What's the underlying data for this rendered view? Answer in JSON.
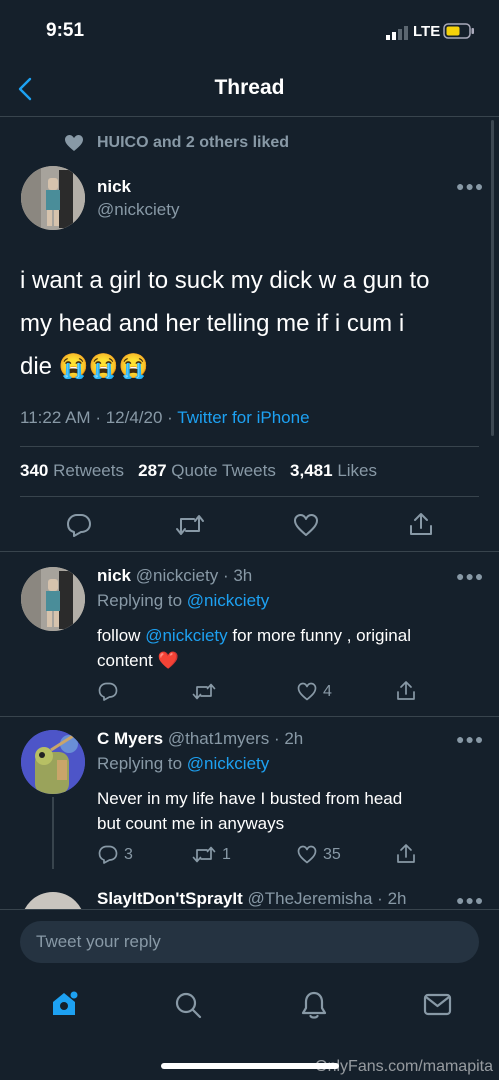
{
  "status_bar": {
    "time": "9:51",
    "network": "LTE"
  },
  "header": {
    "title": "Thread"
  },
  "main_tweet": {
    "social_context": "HUICO and 2 others liked",
    "name": "nick",
    "handle": "@nickciety",
    "text_lines": [
      "i want a girl to suck my dick w a gun to",
      "my head and her telling me if i cum i",
      "die 😭😭😭"
    ],
    "time": "11:22 AM",
    "date": "12/4/20",
    "source": "Twitter for iPhone",
    "retweets_count": "340",
    "retweets_label": "Retweets",
    "quotes_count": "287",
    "quotes_label": "Quote Tweets",
    "likes_count": "3,481",
    "likes_label": "Likes"
  },
  "replies": [
    {
      "name": "nick",
      "handle": "@nickciety",
      "age": "3h",
      "replying_prefix": "Replying to",
      "replying_to": "@nickciety",
      "text_before": "follow",
      "mention": "@nickciety",
      "text_after_line1": "for more funny , original",
      "text_line2": "content ❤️",
      "reply_count": "",
      "retweet_count": "",
      "like_count": "4"
    },
    {
      "name": "C Myers",
      "handle": "@that1myers",
      "age": "2h",
      "replying_prefix": "Replying to",
      "replying_to": "@nickciety",
      "text_line1": "Never in my life have I busted from head",
      "text_line2": "but count me in anyways",
      "reply_count": "3",
      "retweet_count": "1",
      "like_count": "35"
    },
    {
      "name": "SlayItDon'tSprayIt",
      "handle": "@TheJeremisha",
      "age": "2h"
    }
  ],
  "composer": {
    "placeholder": "Tweet your reply"
  },
  "watermark": "OnlyFans.com/mamapita",
  "colors": {
    "background": "#15202b",
    "accent": "#1da1f2",
    "muted": "#8899a6",
    "like_red": "#e0245e"
  }
}
